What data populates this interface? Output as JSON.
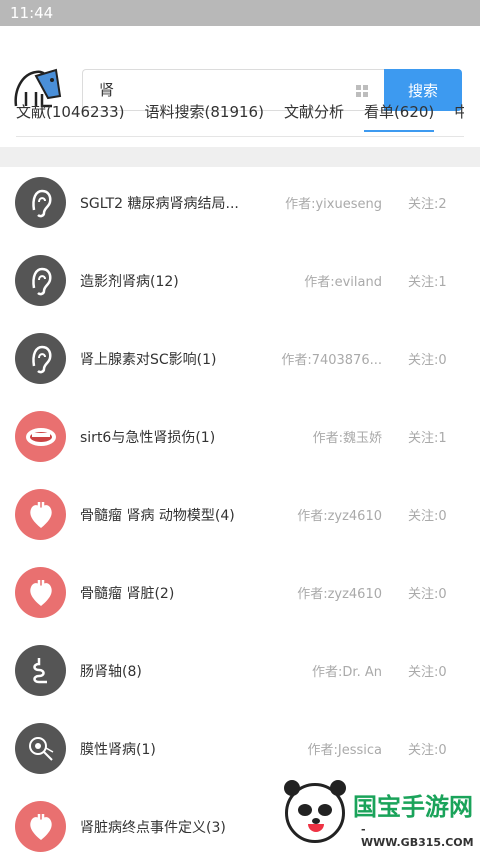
{
  "status_bar": {
    "time": "11:44"
  },
  "search": {
    "value": "肾",
    "button_label": "搜索"
  },
  "tabs": [
    {
      "label": "文献(1046233)"
    },
    {
      "label": "语料搜索(81916)"
    },
    {
      "label": "文献分析"
    },
    {
      "label": "看单(620)",
      "active": true
    },
    {
      "label": "中国"
    }
  ],
  "list": [
    {
      "title": "SGLT2 糖尿病肾病结局...",
      "author": "作者:yixueseng",
      "follow": "关注:2",
      "icon": "ear-icon",
      "color": "#555555"
    },
    {
      "title": "造影剂肾病(12)",
      "author": "作者:eviland",
      "follow": "关注:1",
      "icon": "ear-icon",
      "color": "#555555"
    },
    {
      "title": "肾上腺素对SC影响(1)",
      "author": "作者:7403876...",
      "follow": "关注:0",
      "icon": "ear-icon",
      "color": "#555555"
    },
    {
      "title": "sirt6与急性肾损伤(1)",
      "author": "作者:魏玉娇",
      "follow": "关注:1",
      "icon": "teeth-icon",
      "color": "#e97070"
    },
    {
      "title": "骨髓瘤 肾病 动物模型(4)",
      "author": "作者:zyz4610",
      "follow": "关注:0",
      "icon": "heart-icon",
      "color": "#e97070"
    },
    {
      "title": "骨髓瘤 肾脏(2)",
      "author": "作者:zyz4610",
      "follow": "关注:0",
      "icon": "heart-icon",
      "color": "#e97070"
    },
    {
      "title": "肠肾轴(8)",
      "author": "作者:Dr. An",
      "follow": "关注:0",
      "icon": "intestine-icon",
      "color": "#555555"
    },
    {
      "title": "膜性肾病(1)",
      "author": "作者:Jessica",
      "follow": "关注:0",
      "icon": "cell-icon",
      "color": "#555555"
    },
    {
      "title": "肾脏病终点事件定义(3)",
      "author": "",
      "follow": "",
      "icon": "heart-icon",
      "color": "#e97070"
    }
  ],
  "watermark": {
    "brand": "国宝手游网",
    "url": "- WWW.GB315.COM -"
  }
}
